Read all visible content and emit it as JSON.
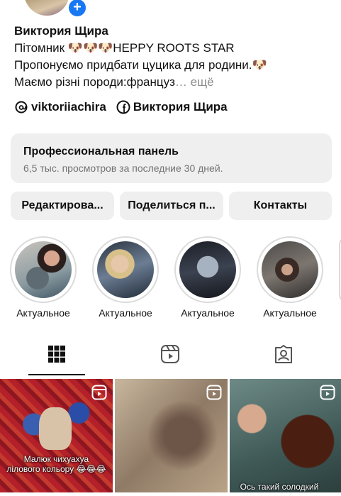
{
  "profile": {
    "name": "Виктория Щира",
    "bio": [
      "Пітомник  🐶🐶🐶HEPPY ROOTS STAR",
      "Пропонуємо придбати цуцика для родини.🐶",
      "Маємо різні породи:француз"
    ],
    "bio_ellipsis": "…",
    "bio_more": "ещё",
    "threads_handle": "viktoriiachira",
    "facebook_name": "Виктория Щира"
  },
  "panel": {
    "title": "Профессиональная панель",
    "subtitle": "6,5 тыс. просмотров за последние 30 дней."
  },
  "actions": {
    "edit": "Редактирова...",
    "share": "Поделиться п...",
    "contacts": "Контакты"
  },
  "highlights": [
    {
      "label": "Актуальное"
    },
    {
      "label": "Актуальное"
    },
    {
      "label": "Актуальное"
    },
    {
      "label": "Актуальное"
    }
  ],
  "tabs": {
    "active": "grid",
    "icons": [
      "grid-icon",
      "reels-icon",
      "tagged-icon"
    ]
  },
  "posts": [
    {
      "caption": "Малюк чихуахуа\nлілового кольору 😂😂😂"
    },
    {
      "caption": ""
    },
    {
      "caption": "Ось такий солодкий"
    }
  ],
  "colors": {
    "accent": "#1877f2",
    "button_bg": "#efefef",
    "muted": "#737373"
  }
}
